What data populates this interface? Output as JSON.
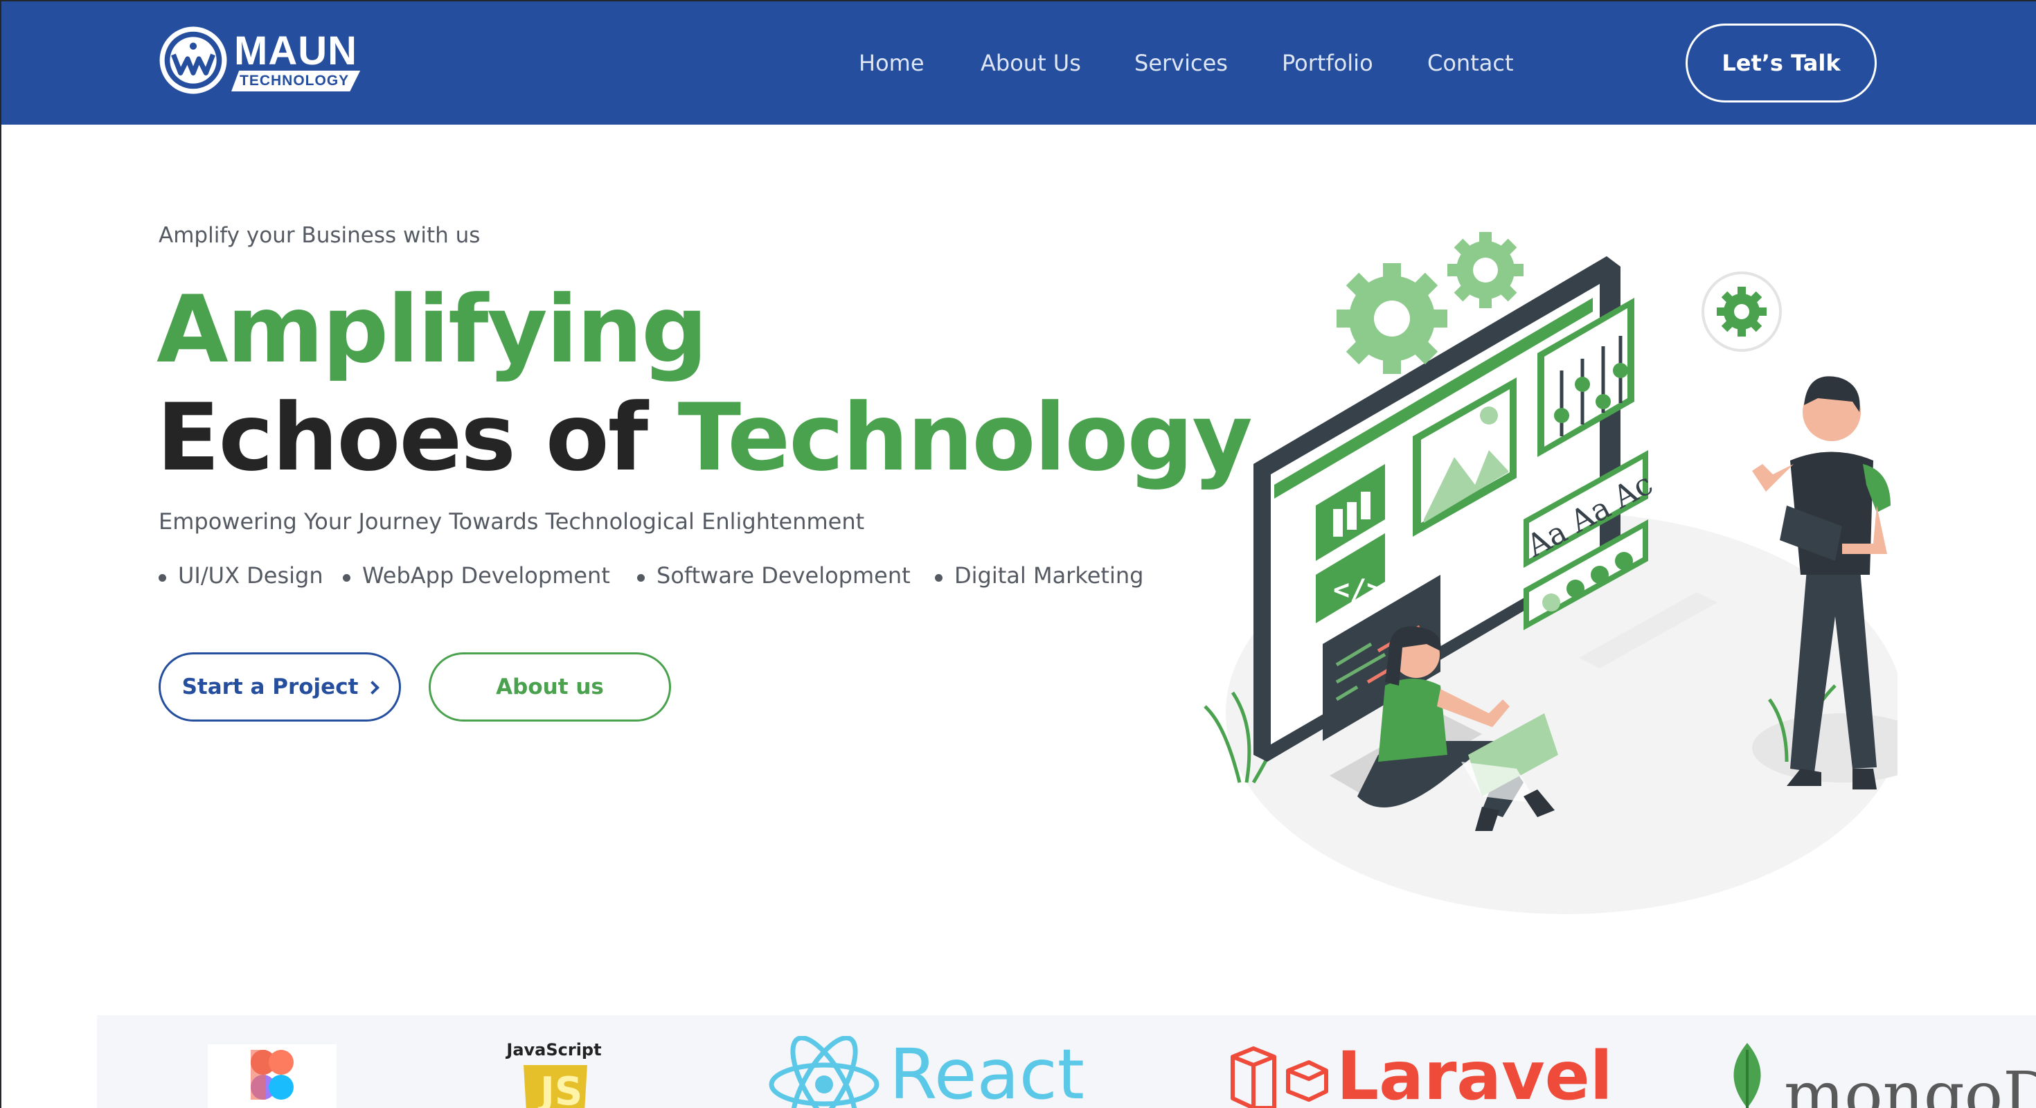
{
  "brand": {
    "name": "MAUN",
    "tagline": "TECHNOLOGY",
    "primary_color": "#254f9e",
    "accent_color": "#4aa24e"
  },
  "nav": {
    "items": [
      {
        "label": "Home"
      },
      {
        "label": "About Us"
      },
      {
        "label": "Services"
      },
      {
        "label": "Portfolio"
      },
      {
        "label": "Contact"
      }
    ],
    "cta_label": "Let’s Talk"
  },
  "hero": {
    "eyebrow": "Amplify your Business with us",
    "headline_line1": "Amplifying",
    "headline_line2_dark": "Echoes of ",
    "headline_line2_green": "Technology",
    "subtitle": "Empowering Your Journey Towards Technological Enlightenment",
    "services": [
      "UI/UX Design",
      "WebApp Development",
      "Software Development",
      "Digital Marketing"
    ],
    "primary_button": "Start a Project",
    "secondary_button": "About us"
  },
  "illustration": {
    "cards": [
      "Aa",
      "Aa",
      "Ac"
    ],
    "icon_names": [
      "gear-icon",
      "code-icon",
      "image-icon",
      "sliders-icon"
    ]
  },
  "tech_logos": {
    "javascript_label": "JavaScript",
    "javascript_badge": "JS",
    "react": "React",
    "laravel": "Laravel",
    "mongodb": "mongoDB"
  }
}
